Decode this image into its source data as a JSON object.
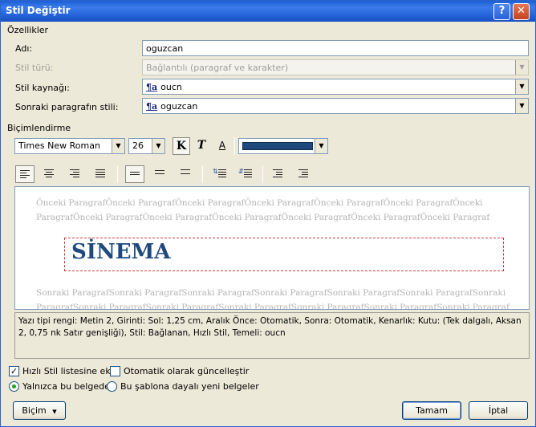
{
  "window": {
    "title": "Stil Değiştir",
    "help_btn": "?",
    "close_btn": "✕"
  },
  "properties": {
    "group_label": "Özellikler",
    "name_label": "Adı:",
    "name_value": "oguzcan",
    "type_label": "Stil türü:",
    "type_value": "Bağlantılı (paragraf ve karakter)",
    "based_label": "Stil kaynağı:",
    "based_value": "oucn",
    "next_label": "Sonraki paragrafın stili:",
    "next_value": "oguzcan",
    "style_symbol": "¶a"
  },
  "formatting": {
    "group_label": "Biçimlendirme",
    "font": "Times New Roman",
    "size": "26",
    "bold_glyph": "K",
    "italic_glyph": "T",
    "underline_glyph": "A",
    "font_color": "#1f497d"
  },
  "preview": {
    "prev_text": "Önceki ParagrafÖnceki ParagrafÖnceki ParagrafÖnceki ParagrafÖnceki ParagrafÖnceki ParagrafÖnceki ParagrafÖnceki ParagrafÖnceki ParagrafÖnceki ParagrafÖnceki ParagrafÖnceki ParagrafÖnceki Paragraf",
    "sample_text": "SİNEMA",
    "next_text": "Sonraki ParagrafSonraki ParagrafSonraki ParagrafSonraki ParagrafSonraki ParagrafSonraki ParagrafSonraki ParagrafSonraki ParagrafSonraki ParagrafSonraki ParagrafSonraki ParagrafSonraki ParagrafSonraki Paragraf"
  },
  "description": "Yazı tipi rengi: Metin 2, Girinti: Sol:  1,25 cm, Aralık Önce:  Otomatik, Sonra:  Otomatik, Kenarlık: Kutu: (Tek dalgalı, Aksan 2,  0,75 nk Satır genişliği), Stil: Bağlanan, Hızlı Stil, Temeli: oucn",
  "options": {
    "quick_style": "Hızlı Stil listesine ekle",
    "auto_update": "Otomatik olarak güncelleştir",
    "only_doc": "Yalnızca bu belgede",
    "new_docs": "Bu şablona dayalı yeni belgeler"
  },
  "buttons": {
    "format": "Biçim",
    "format_arrow": "▼",
    "ok": "Tamam",
    "cancel": "İptal"
  }
}
